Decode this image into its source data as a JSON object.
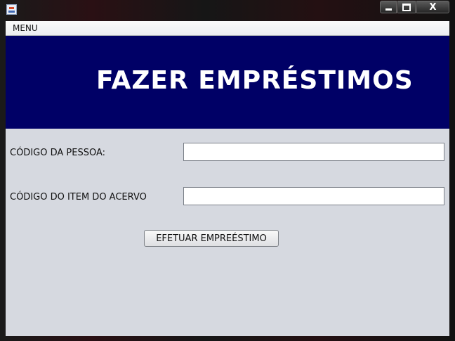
{
  "window": {
    "icon": "java-cup-icon",
    "controls": {
      "minimize": "minimize-icon",
      "maximize": "maximize-icon",
      "close_label": "X"
    }
  },
  "menubar": {
    "items": [
      {
        "label": "MENU"
      }
    ]
  },
  "banner": {
    "title": "FAZER EMPRÉSTIMOS",
    "background": "#000066",
    "text_color": "#ffffff"
  },
  "form": {
    "person_code": {
      "label": "CÓDIGO DA PESSOA:",
      "value": ""
    },
    "item_code": {
      "label": "CÓDIGO DO ITEM DO ACERVO",
      "value": ""
    },
    "submit_label": "EFETUAR EMPREÉSTIMO"
  },
  "colors": {
    "content_background": "#d6d9e0",
    "window_frame": "#1a1a1a"
  }
}
